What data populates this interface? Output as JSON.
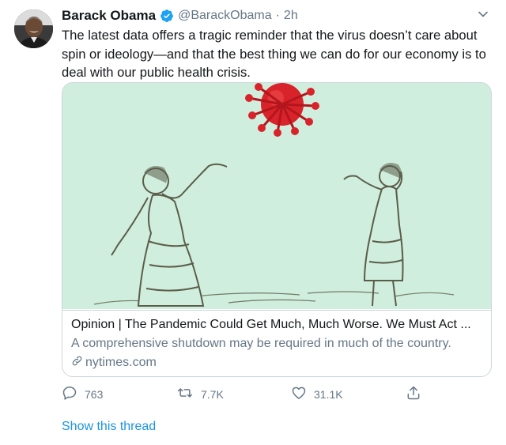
{
  "tweet": {
    "author_name": "Barack Obama",
    "handle": "@BarackObama",
    "separator": "·",
    "timestamp": "2h",
    "text": "The latest data offers a tragic reminder that the virus doesn’t care about spin or ideology—and that the best thing we can do for our economy is to deal with our public health crisis."
  },
  "card": {
    "title": "Opinion | The Pandemic Could Get Much, Much Worse. We Must Act ...",
    "description": "A comprehensive shutdown may be required in much of the country.",
    "domain": "nytimes.com",
    "image_subject": "illustration of two children tossing a coronavirus particle like a ball"
  },
  "actions": {
    "replies": "763",
    "retweets": "7.7K",
    "likes": "31.1K"
  },
  "show_thread_label": "Show this thread",
  "colors": {
    "link_blue": "#1b95e0",
    "verified_blue": "#1da1f2",
    "muted_gray": "#657786",
    "card_image_bg": "#cfeedd",
    "virus_red": "#d8232a"
  },
  "icons": [
    "verified-badge-icon",
    "chevron-down-icon",
    "link-icon",
    "reply-icon",
    "retweet-icon",
    "like-icon",
    "share-icon"
  ]
}
